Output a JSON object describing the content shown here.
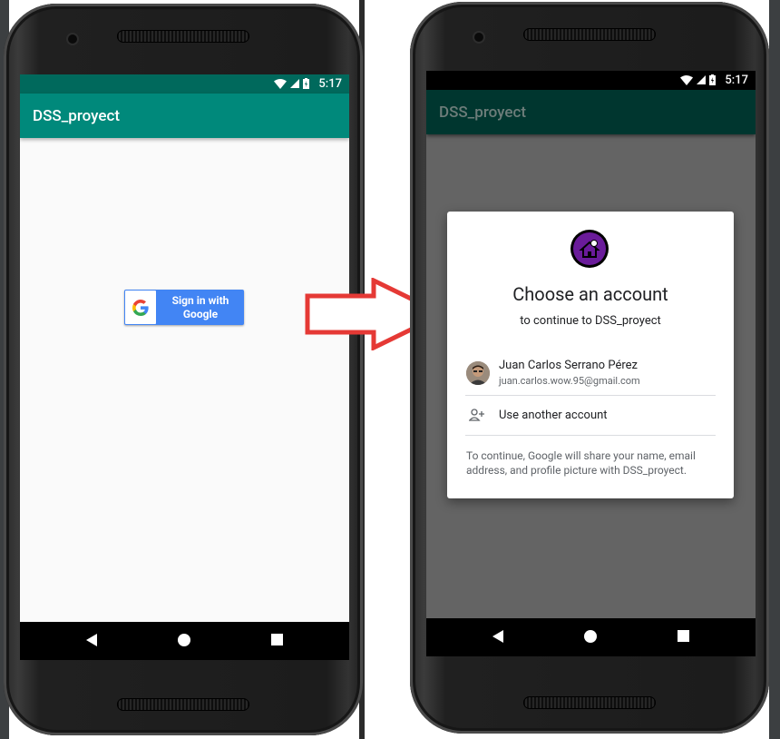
{
  "colors": {
    "teal_primary": "#00897b",
    "teal_dark": "#00695c",
    "teal_primary_dimmed": "#003a33",
    "teal_dark_dimmed": "#002a25",
    "google_blue": "#4285f4",
    "arrow_red": "#e53935",
    "logo_purple": "#6a1b9a"
  },
  "left_screen": {
    "status_time": "5:17",
    "app_title": "DSS_proyect",
    "signin_button": {
      "line1": "Sign in with",
      "line2": "Google",
      "icon": "google-g-icon"
    }
  },
  "transition_icon": "right-arrow-icon",
  "right_screen": {
    "status_time": "5:17",
    "app_title": "DSS_proyect",
    "dialog": {
      "title": "Choose an account",
      "subtitle": "to continue to DSS_proyect",
      "account": {
        "name": "Juan Carlos Serrano Pérez",
        "email": "juan.carlos.wow.95@gmail.com"
      },
      "use_another": "Use another account",
      "note": "To continue, Google will share your name, email address, and profile picture with DSS_proyect."
    }
  }
}
